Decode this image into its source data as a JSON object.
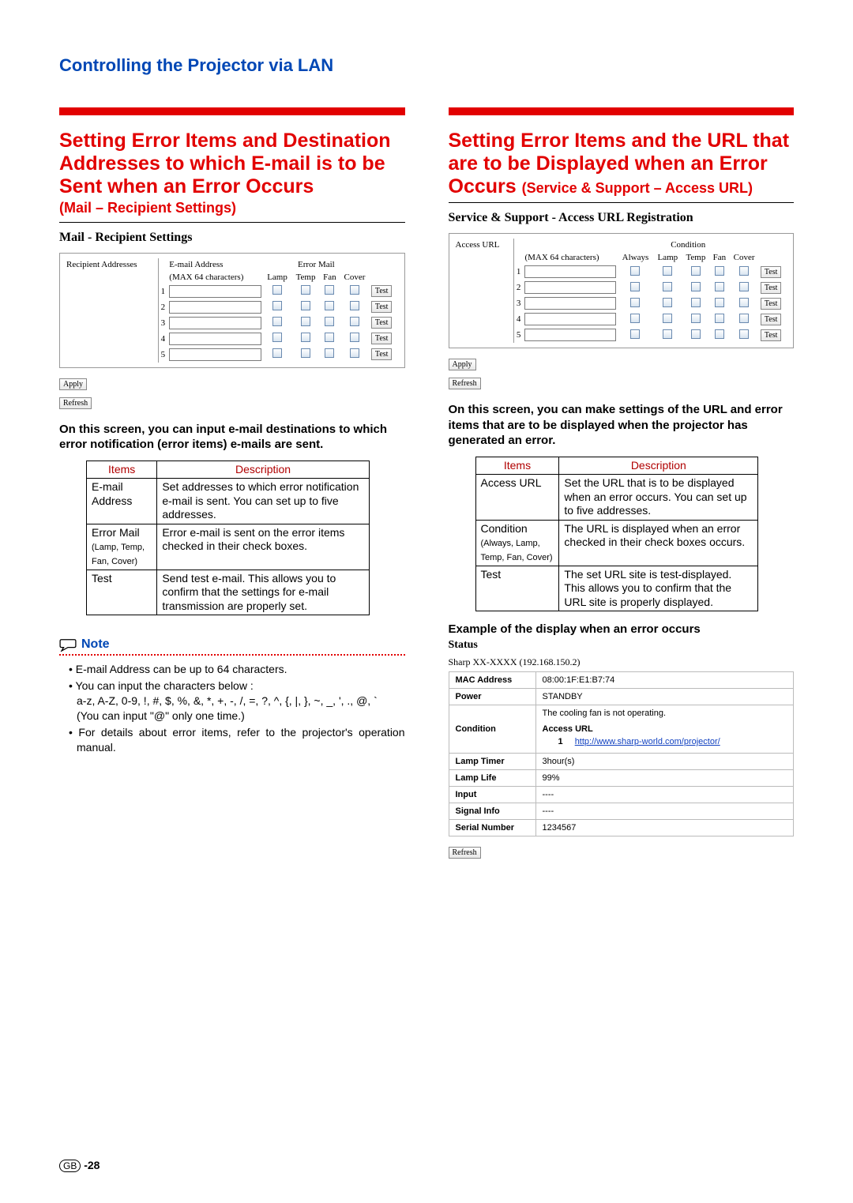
{
  "page_title": "Controlling the Projector via LAN",
  "left": {
    "heading": "Setting Error Items and Destination Addresses to which E-mail is to be Sent when an Error Occurs",
    "sub": "(Mail – Recipient Settings)",
    "panel_title": "Mail - Recipient Settings",
    "col_recipient": "Recipient Addresses",
    "col_email": "E-mail Address",
    "col_max": "(MAX 64 characters)",
    "col_errormail": "Error Mail",
    "cols": {
      "lamp": "Lamp",
      "temp": "Temp",
      "fan": "Fan",
      "cover": "Cover"
    },
    "rows": [
      "1",
      "2",
      "3",
      "4",
      "5"
    ],
    "test": "Test",
    "apply": "Apply",
    "refresh": "Refresh",
    "para": "On this screen, you can input e-mail destinations to which error notification (error items) e-mails are sent.",
    "table": {
      "h_items": "Items",
      "h_desc": "Description",
      "r1_item": "E-mail Address",
      "r1_desc": "Set addresses to which error notification e-mail is sent. You can set up to five addresses.",
      "r2_item": "Error Mail",
      "r2_sub": "(Lamp, Temp, Fan, Cover)",
      "r2_desc": "Error e-mail is sent on the error items checked in their check boxes.",
      "r3_item": "Test",
      "r3_desc": "Send test e-mail. This allows you to confirm that the settings for e-mail transmission are properly set."
    },
    "note_label": "Note",
    "notes": {
      "n1": "E-mail Address can be up to 64 characters.",
      "n2": "You can input the characters below :",
      "n2b": "a-z, A-Z, 0-9, !, #, $, %, &, *, +, -, /, =, ?, ^, {, |, }, ~, _, ', ., @, `",
      "n2c": "(You can input \"@\" only one time.)",
      "n3": "For details about error items, refer to the projector's operation manual."
    }
  },
  "right": {
    "heading_1": "Setting Error Items and the URL that are to be Displayed when an Error Occurs ",
    "heading_2": "(Service & Support – Access URL)",
    "panel_title": "Service & Support - Access URL Registration",
    "col_access": "Access URL",
    "col_max": "(MAX 64 characters)",
    "col_condition": "Condition",
    "cols": {
      "always": "Always",
      "lamp": "Lamp",
      "temp": "Temp",
      "fan": "Fan",
      "cover": "Cover"
    },
    "rows": [
      "1",
      "2",
      "3",
      "4",
      "5"
    ],
    "test": "Test",
    "apply": "Apply",
    "refresh": "Refresh",
    "para": "On this screen, you can make settings of the URL and error items that are to be displayed when the projector has generated an error.",
    "table": {
      "h_items": "Items",
      "h_desc": "Description",
      "r1_item": "Access URL",
      "r1_desc": "Set the URL that is to be displayed when an error occurs. You can set up to five addresses.",
      "r2_item": "Condition",
      "r2_sub": "(Always, Lamp, Temp, Fan, Cover)",
      "r2_desc": "The URL is displayed when an error checked in their check boxes occurs.",
      "r3_item": "Test",
      "r3_desc": "The set URL site is test-displayed. This allows you to confirm that the URL site is properly displayed."
    },
    "example_hd": "Example of the display when an error occurs",
    "status_title": "Status",
    "status_head": "Sharp XX-XXXX   (192.168.150.2)",
    "status": {
      "mac_l": "MAC Address",
      "mac_v": "08:00:1F:E1:B7:74",
      "power_l": "Power",
      "power_v": "STANDBY",
      "cond_l": "Condition",
      "cond_v1": "The cooling fan is not operating.",
      "cond_access": "Access URL",
      "cond_link_num": "1",
      "cond_link": "http://www.sharp-world.com/projector/",
      "lt_l": "Lamp Timer",
      "lt_v": "3hour(s)",
      "ll_l": "Lamp Life",
      "ll_v": "99%",
      "in_l": "Input",
      "in_v": "----",
      "si_l": "Signal Info",
      "si_v": "----",
      "sn_l": "Serial Number",
      "sn_v": "1234567"
    },
    "refresh2": "Refresh"
  },
  "page_gb": "GB",
  "page_num": "-28"
}
